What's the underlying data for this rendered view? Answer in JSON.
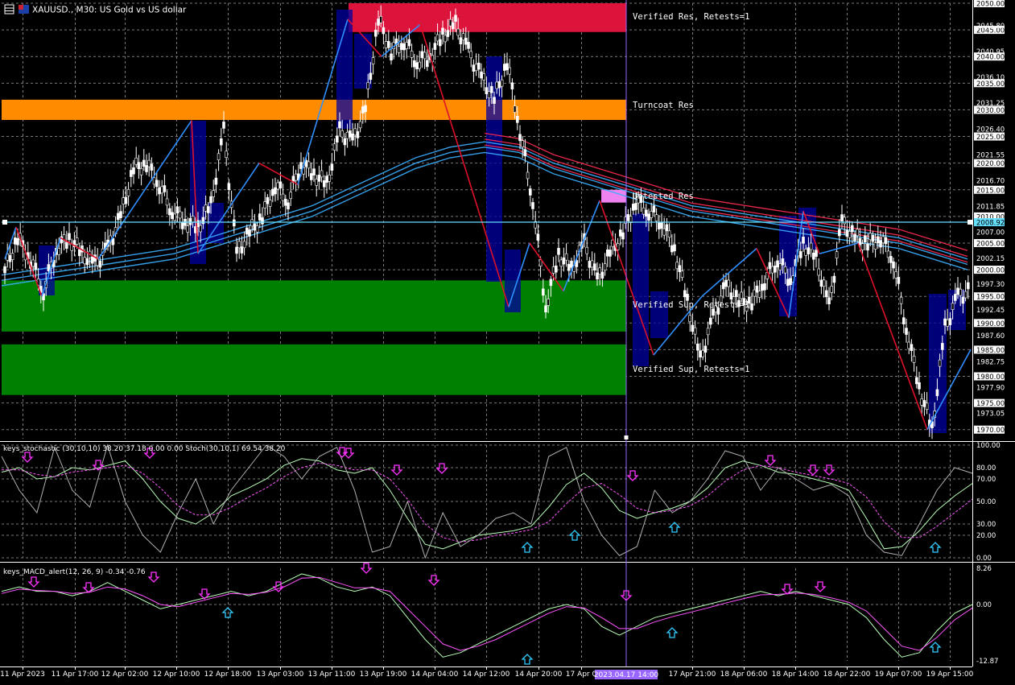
{
  "window": {
    "title": "XAUUSD., M30: US Gold vs US dollar",
    "icons": [
      "grid-icon",
      "symbol-flag-icon"
    ]
  },
  "colors": {
    "background": "#000000",
    "grid": "#7a7a7a",
    "text": "#ffffff",
    "axis_line": "#ffffff",
    "bull_candle": "#ffffff",
    "bear_candle": "#ffffff",
    "zigzag_up": "#2f8fff",
    "zigzag_down": "#e0102a",
    "ma_blue": "#3ab0ff",
    "ma_red": "#e8284c",
    "crosshair_h": "#66e0ff",
    "crosshair_v": "#9966ff",
    "zone_verified_res": "#dc143c",
    "zone_turncoat_res": "#ff8c00",
    "zone_untested_res": "#ee82ee",
    "zone_verified_sup": "#008000",
    "block_navy": "#0000a0",
    "stoch_main": "#b8ffb8",
    "stoch_signal": "#ff55ff",
    "stoch_raw": "#b0b0b0",
    "macd_main": "#b8ffb8",
    "macd_signal": "#ff55ff",
    "arrow_down": "#ff33ff",
    "arrow_up": "#33ccff"
  },
  "chart_data": [
    {
      "type": "line",
      "title": "XAUUSD., M30: US Gold vs US dollar",
      "ylim": [
        1968.3,
        2050.0
      ],
      "y_ticks": [
        "2050.00",
        "2045.00",
        "2040.00",
        "2035.00",
        "2030.00",
        "2025.00",
        "2020.00",
        "2015.00",
        "2010.00",
        "2005.00",
        "2000.00",
        "1995.00",
        "1990.00",
        "1985.00",
        "1980.00",
        "1975.00",
        "1970.00"
      ],
      "y_minor_ticks": [
        "2045.80",
        "2040.95",
        "2036.10",
        "2031.25",
        "2026.40",
        "2021.55",
        "2016.70",
        "2011.85",
        "2007.00",
        "2002.15",
        "1997.30",
        "1992.45",
        "1987.60",
        "1982.75",
        "1977.90",
        "1973.05"
      ],
      "x_ticks": [
        "11 Apr 2023",
        "11 Apr 17:00",
        "12 Apr 02:00",
        "12 Apr 10:00",
        "12 Apr 18:00",
        "13 Apr 03:00",
        "13 Apr 11:00",
        "13 Apr 19:00",
        "14 Apr 04:00",
        "14 Apr 12:00",
        "14 Apr 20:00",
        "17 Apr 0",
        "17 Apr 21:00",
        "18 Apr 06:00",
        "18 Apr 14:00",
        "18 Apr 22:00",
        "19 Apr 07:00",
        "19 Apr 15:00"
      ],
      "crosshair": {
        "price": "2008.92",
        "time": "2023.04.17 14:00"
      },
      "zones": [
        {
          "label": "Verified Res, Retests=1",
          "top": 2050.0,
          "bottom": 2044.6,
          "kind": "verified_res"
        },
        {
          "label": "Turncoat Res",
          "top": 2031.9,
          "bottom": 2028.1,
          "kind": "turncoat_res"
        },
        {
          "label": "Untested Res",
          "top": 2015.0,
          "bottom": 2012.6,
          "kind": "untested_res"
        },
        {
          "label": "Verified Sup, Retests=1",
          "top": 1998.0,
          "bottom": 1988.4,
          "kind": "verified_sup"
        },
        {
          "label": "Verified Sup, Retests=1",
          "top": 1986.0,
          "bottom": 1976.5,
          "kind": "verified_sup"
        }
      ],
      "price_path": [
        2000,
        2006,
        2002,
        1996,
        2004,
        2006,
        2003,
        2001,
        2004,
        2010,
        2019,
        2020,
        2016,
        2011,
        2009,
        2008,
        2012,
        2026,
        2003,
        2007,
        2010,
        2016,
        2013,
        2020,
        2018,
        2016,
        2026,
        2024,
        2030,
        2047,
        2041,
        2043,
        2039,
        2040,
        2044,
        2046,
        2041,
        2036,
        2032,
        2039,
        2026,
        2013,
        1993,
        2003,
        2000,
        2005,
        1998,
        2003,
        2007,
        2013,
        2011,
        2009,
        2004,
        1994,
        1983,
        1991,
        1997,
        1994,
        1994,
        1998,
        2002,
        1998,
        2005,
        2002,
        1993,
        2009,
        2006,
        2005,
        2006,
        2002,
        1989,
        1978,
        1970,
        1989,
        1995,
        1996
      ]
    },
    {
      "type": "line",
      "title": "keys_stochastic (30,10,10) 38.20 37.18 0.00 0.00 Stoch(30,10,1) 69.54 38.20",
      "ylim": [
        0,
        100
      ],
      "y_ticks": [
        "100.00",
        "80.00",
        "70.00",
        "50.00",
        "30.00",
        "20.00",
        "0.00"
      ],
      "series": [
        {
          "values": [
            76,
            80,
            70,
            72,
            80,
            78,
            82,
            86,
            70,
            50,
            35,
            30,
            40,
            55,
            62,
            70,
            82,
            88,
            86,
            78,
            75,
            80,
            60,
            35,
            12,
            8,
            14,
            20,
            22,
            24,
            28,
            45,
            65,
            75,
            62,
            42,
            35,
            40,
            44,
            50,
            62,
            80,
            86,
            82,
            76,
            74,
            70,
            66,
            60,
            35,
            8,
            10,
            24,
            42,
            55,
            66
          ]
        },
        {
          "values": [
            78,
            78,
            74,
            72,
            76,
            78,
            80,
            82,
            75,
            62,
            46,
            38,
            38,
            45,
            54,
            62,
            72,
            80,
            84,
            82,
            78,
            78,
            70,
            52,
            30,
            18,
            14,
            16,
            20,
            22,
            25,
            32,
            48,
            62,
            66,
            56,
            44,
            40,
            42,
            46,
            55,
            68,
            78,
            82,
            80,
            76,
            73,
            70,
            66,
            54,
            32,
            18,
            18,
            28,
            40,
            52
          ]
        },
        {
          "values": [
            90,
            60,
            40,
            98,
            60,
            45,
            100,
            50,
            20,
            5,
            40,
            70,
            30,
            60,
            80,
            100,
            90,
            70,
            90,
            98,
            60,
            5,
            10,
            50,
            0,
            40,
            10,
            20,
            35,
            40,
            30,
            90,
            98,
            50,
            20,
            2,
            10,
            60,
            40,
            50,
            70,
            95,
            90,
            60,
            80,
            70,
            60,
            65,
            55,
            20,
            5,
            2,
            30,
            60,
            80,
            75
          ]
        }
      ]
    },
    {
      "type": "line",
      "title": "keys_MACD_alert(12, 26, 9) -0.34 -0.76",
      "ylim": [
        -12.87,
        8.26
      ],
      "y_ticks": [
        "8.26",
        "0.00",
        "-12.87"
      ],
      "series": [
        {
          "values": [
            3,
            4,
            3,
            3,
            2,
            3,
            5,
            3,
            1,
            -1,
            0,
            1,
            2,
            3,
            2,
            3,
            5,
            7,
            6,
            4,
            3,
            4,
            2,
            -3,
            -8,
            -12,
            -11,
            -9,
            -7,
            -5,
            -3,
            -1,
            0,
            -1,
            -5,
            -7,
            -5,
            -3,
            -2,
            -1,
            0,
            1,
            2,
            3,
            2,
            3,
            2,
            1,
            0,
            -3,
            -8,
            -12,
            -11,
            -6,
            -2,
            0
          ]
        },
        {
          "values": [
            2.5,
            3.5,
            3.2,
            3,
            2.5,
            2.8,
            4,
            3.5,
            2,
            0,
            -0.5,
            0.5,
            1.5,
            2.5,
            2.3,
            2.8,
            4,
            6,
            6.2,
            5,
            3.8,
            3.8,
            3,
            -1,
            -5,
            -9,
            -10.5,
            -9.5,
            -8,
            -6,
            -4,
            -2,
            -0.5,
            -0.8,
            -3,
            -5.5,
            -5.5,
            -4,
            -2.8,
            -1.8,
            -0.8,
            0.3,
            1.3,
            2.2,
            2.3,
            2.6,
            2.3,
            1.5,
            0.5,
            -1.5,
            -5.5,
            -9.5,
            -10.5,
            -7.5,
            -3.5,
            -0.8
          ]
        }
      ]
    }
  ]
}
